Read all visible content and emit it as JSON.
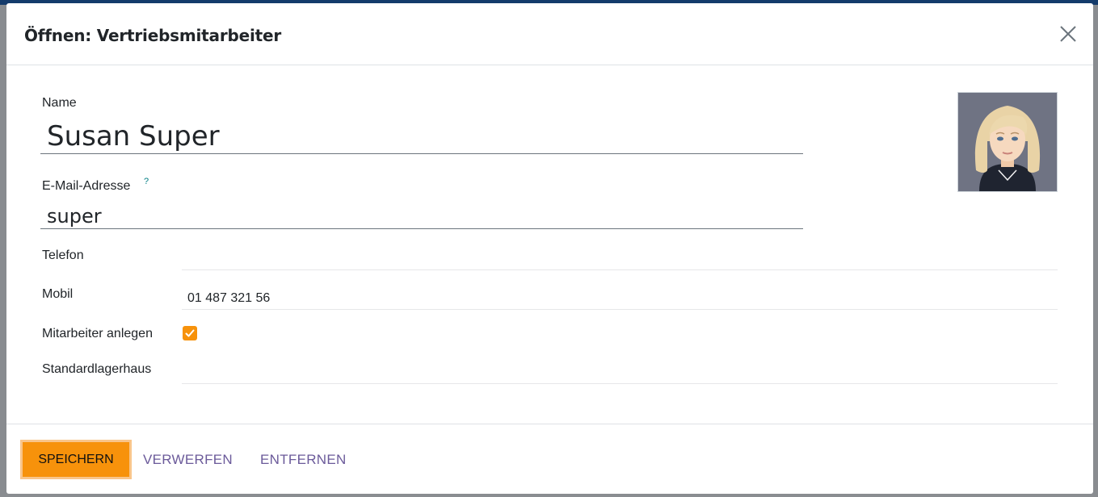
{
  "modal": {
    "title": "Öffnen: Vertriebsmitarbeiter"
  },
  "form": {
    "name_label": "Name",
    "name_value": "Susan Super",
    "email_label": "E-Mail-Adresse",
    "email_help": "?",
    "email_value": "super",
    "phone_label": "Telefon",
    "phone_value": "",
    "mobile_label": "Mobil",
    "mobile_value": "01 487 321 56",
    "create_employee_label": "Mitarbeiter anlegen",
    "create_employee_checked": true,
    "warehouse_label": "Standardlagerhaus",
    "warehouse_value": ""
  },
  "footer": {
    "save_label": "SPEICHERN",
    "discard_label": "VERWERFEN",
    "remove_label": "ENTFERNEN"
  },
  "colors": {
    "accent": "#f7920b",
    "link": "#6b5a9a",
    "nav": "#143b6b"
  },
  "icons": {
    "close": "close-icon",
    "check": "checkmark-icon",
    "avatar": "avatar-image"
  }
}
